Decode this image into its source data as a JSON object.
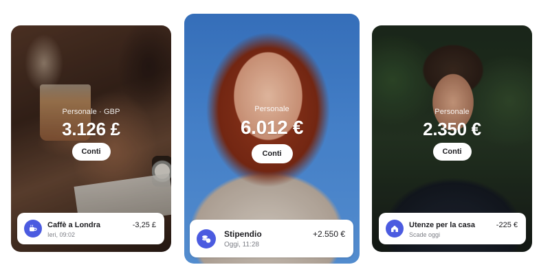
{
  "accent_color": "#4b5be0",
  "cards": [
    {
      "account_label": "Personale · GBP",
      "balance": "3.126 £",
      "button_label": "Conti",
      "transaction": {
        "icon": "coffee-cup-icon",
        "name": "Caffè a Londra",
        "subtitle": "Ieri, 09:02",
        "amount": "-3,25 £"
      }
    },
    {
      "account_label": "Personale",
      "balance": "6.012 €",
      "button_label": "Conti",
      "transaction": {
        "icon": "coins-icon",
        "name": "Stipendio",
        "subtitle": "Oggi, 11:28",
        "amount": "+2.550 €"
      }
    },
    {
      "account_label": "Personale",
      "balance": "2.350 €",
      "button_label": "Conti",
      "transaction": {
        "icon": "house-icon",
        "name": "Utenze per la casa",
        "subtitle": "Scade oggi",
        "amount": "-225 €"
      }
    }
  ]
}
